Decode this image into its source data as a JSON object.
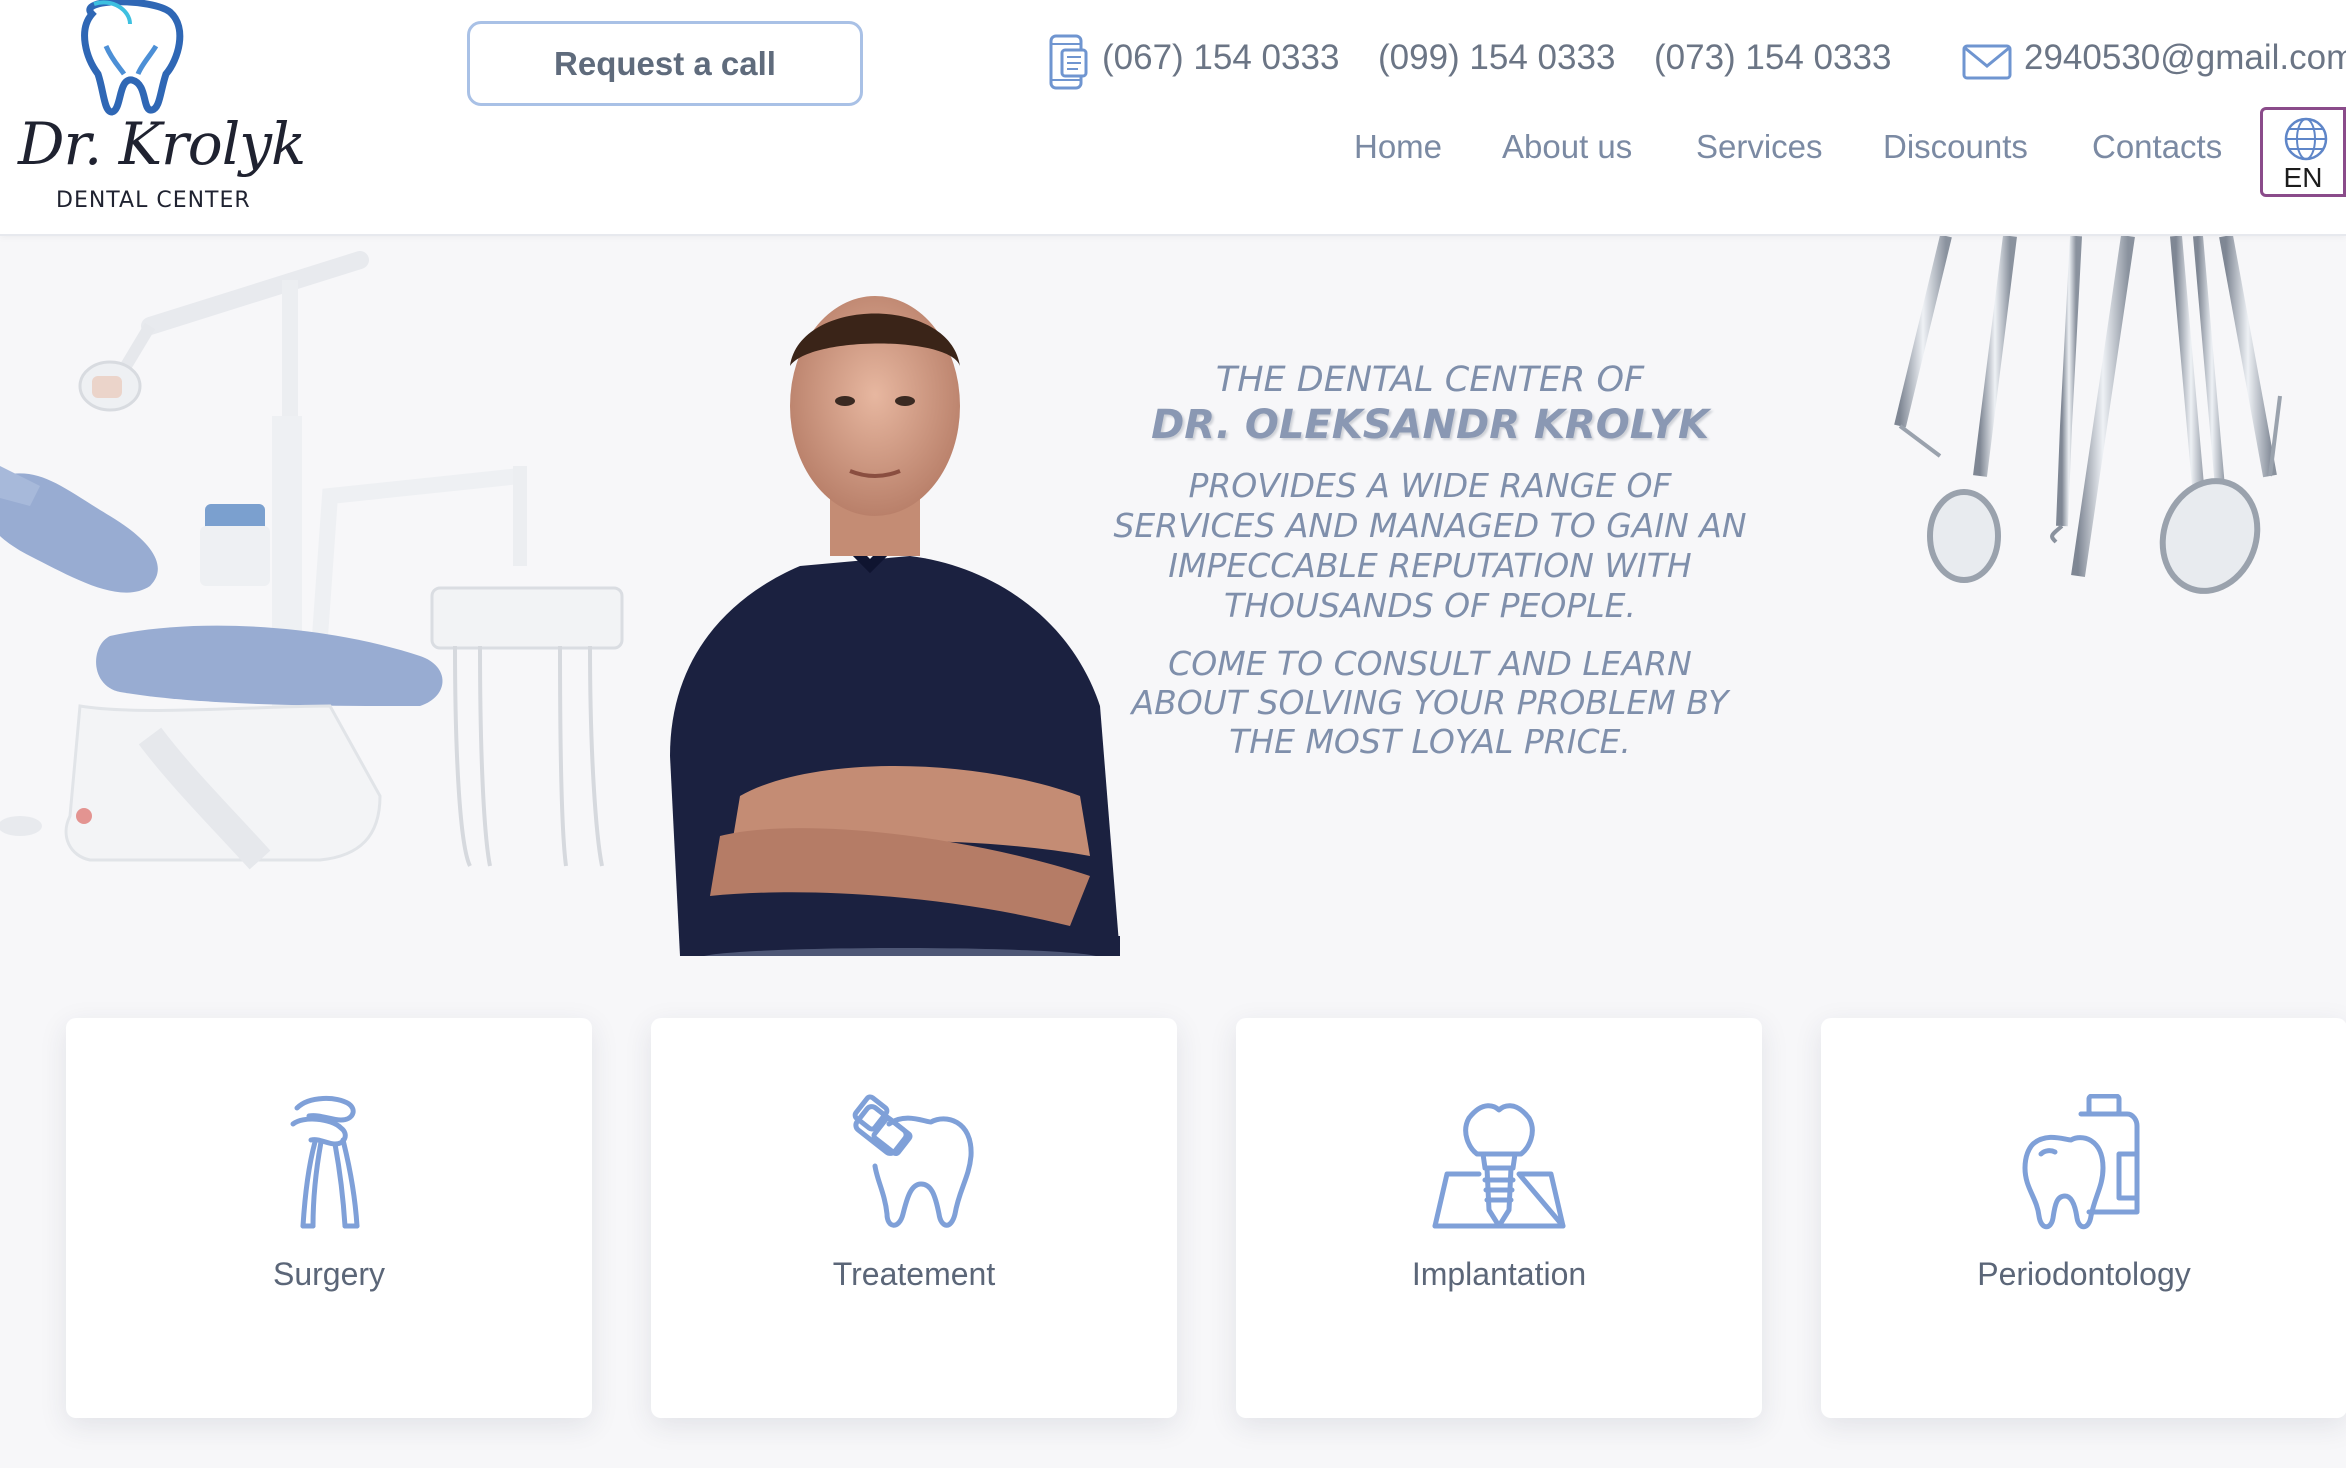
{
  "header": {
    "logo": {
      "name": "Dr. Krolyk",
      "subtitle": "DENTAL CENTER"
    },
    "request_call_label": "Request a call",
    "phones": [
      "(067) 154 0333",
      "(099) 154 0333",
      "(073) 154 0333"
    ],
    "email": "2940530@gmail.com",
    "nav": [
      "Home",
      "About us",
      "Services",
      "Discounts",
      "Contacts"
    ],
    "language": "EN",
    "icons": {
      "phone": "phone-icon",
      "mail": "mail-icon",
      "language": "globe-icon"
    }
  },
  "hero": {
    "line1": "THE DENTAL CENTER OF",
    "line2": "DR. OLEKSANDR KROLYK",
    "paragraph1": "PROVIDES A WIDE RANGE OF SERVICES AND MANAGED TO GAIN AN IMPECCABLE REPUTATION WITH THOUSANDS OF PEOPLE.",
    "paragraph2": "COME TO CONSULT AND LEARN ABOUT SOLVING YOUR PROBLEM BY THE MOST LOYAL PRICE."
  },
  "services": [
    {
      "label": "Surgery",
      "icon": "forceps-icon"
    },
    {
      "label": "Treatement",
      "icon": "tooth-bandage-icon"
    },
    {
      "label": "Implantation",
      "icon": "implant-icon"
    },
    {
      "label": "Periodontology",
      "icon": "tooth-mouthwash-icon"
    }
  ],
  "colors": {
    "accent": "#7fa0d8",
    "chair": "#98acd2",
    "text": "#5b6678",
    "lang_border": "#8a4b8a"
  }
}
